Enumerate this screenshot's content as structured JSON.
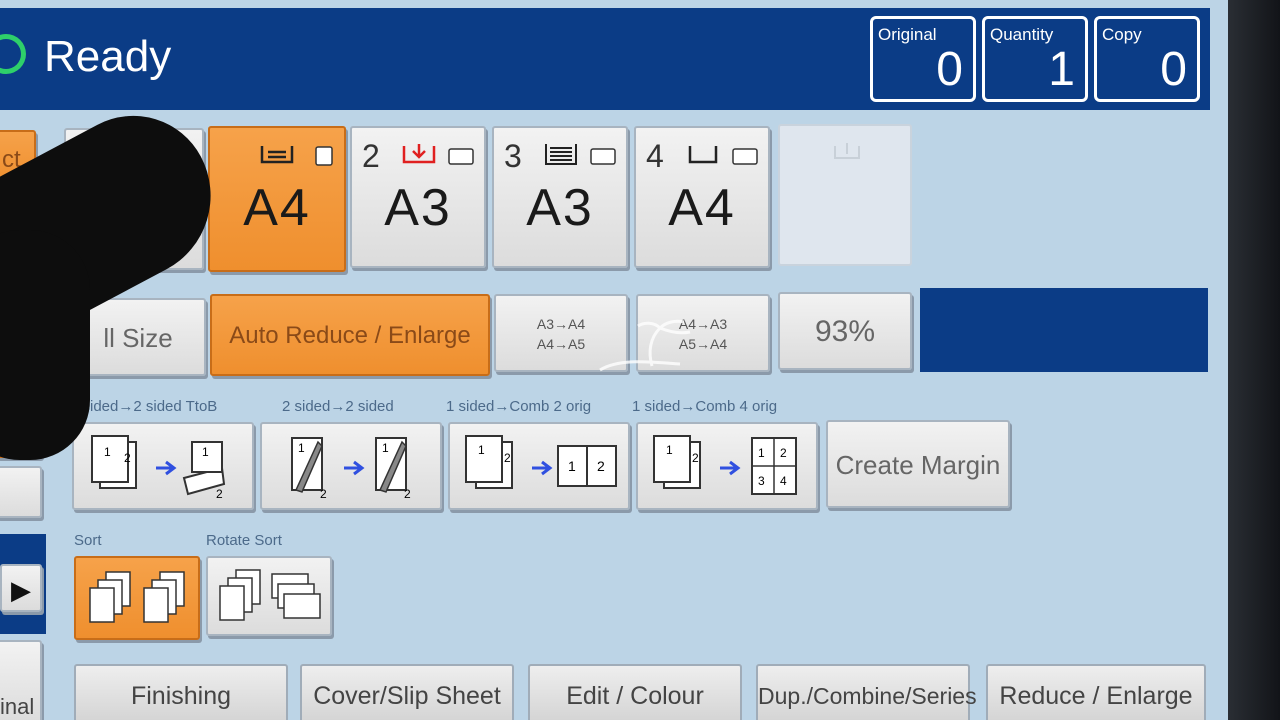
{
  "status": {
    "title": "Ready"
  },
  "counters": [
    {
      "label": "Original",
      "value": "0"
    },
    {
      "label": "Quantity",
      "value": "1"
    },
    {
      "label": "Copy",
      "value": "0"
    }
  ],
  "left_edge": {
    "top_button": "ct",
    "play_icon": "▶",
    "bottom_label": "inal"
  },
  "paper_trays": [
    {
      "number": "",
      "size": "A4",
      "selected": true
    },
    {
      "number": "2",
      "size": "A3"
    },
    {
      "number": "3",
      "size": "A3"
    },
    {
      "number": "4",
      "size": "A4"
    }
  ],
  "ratio": {
    "full_size": "ll Size",
    "auto": "Auto Reduce / Enlarge",
    "preset1_line1": "A3→A4",
    "preset1_line2": "A4→A5",
    "preset2_line1": "A4→A3",
    "preset2_line2": "A5→A4",
    "percent": "93%"
  },
  "duplex": {
    "captions": [
      "1 sided→2 sided TtoB",
      "2 sided→2 sided",
      "1 sided→Comb 2 orig",
      "1 sided→Comb 4 orig"
    ],
    "create_margin": "Create Margin"
  },
  "sort": {
    "caption_sort": "Sort",
    "caption_rotate": "Rotate Sort"
  },
  "tabs": [
    "Finishing",
    "Cover/Slip Sheet",
    "Edit / Colour",
    "Dup./Combine/Series",
    "Reduce / Enlarge"
  ],
  "colors": {
    "header": "#0b3c86",
    "selected": "#ef8f2e",
    "panel": "#bcd4e6"
  }
}
